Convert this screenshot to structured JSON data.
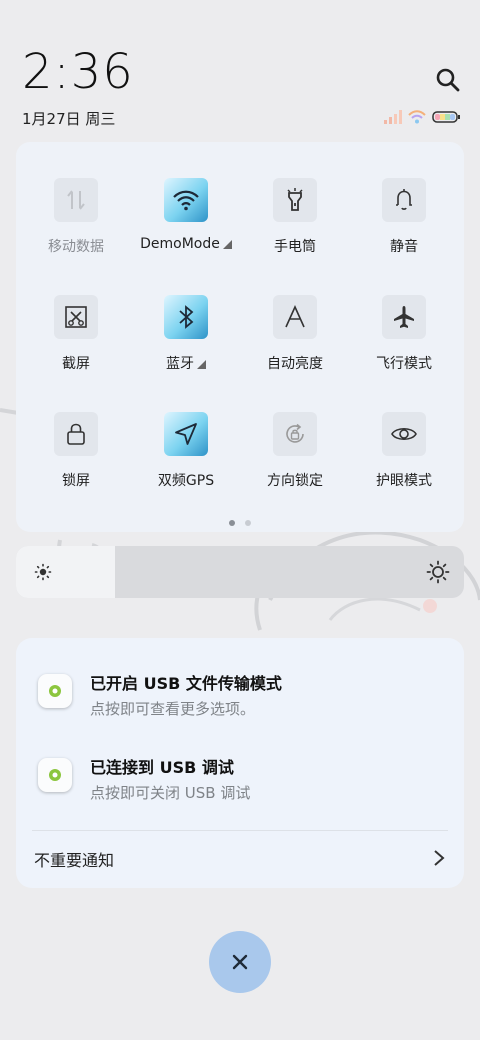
{
  "status": {
    "time": "2:36",
    "date": "1月27日 周三"
  },
  "quick_tiles": {
    "row1": [
      {
        "label": "移动数据",
        "icon": "mobile-data-icon",
        "active": false
      },
      {
        "label": "DemoMode",
        "icon": "wifi-icon",
        "active": true
      },
      {
        "label": "手电筒",
        "icon": "flashlight-icon",
        "active": false
      },
      {
        "label": "静音",
        "icon": "bell-icon",
        "active": false
      }
    ],
    "row2": [
      {
        "label": "截屏",
        "icon": "screenshot-icon",
        "active": false
      },
      {
        "label": "蓝牙",
        "icon": "bluetooth-icon",
        "active": true
      },
      {
        "label": "自动亮度",
        "icon": "auto-brightness-icon",
        "active": false
      },
      {
        "label": "飞行模式",
        "icon": "airplane-icon",
        "active": false
      }
    ],
    "row3": [
      {
        "label": "锁屏",
        "icon": "lock-icon",
        "active": false
      },
      {
        "label": "双频GPS",
        "icon": "location-arrow-icon",
        "active": true
      },
      {
        "label": "方向锁定",
        "icon": "rotation-lock-icon",
        "active": false
      },
      {
        "label": "护眼模式",
        "icon": "eye-icon",
        "active": false
      }
    ],
    "pages": 2,
    "current_page": 1
  },
  "brightness": {
    "level": 0.22
  },
  "notifications": [
    {
      "title": "已开启 USB 文件传输模式",
      "subtitle": "点按即可查看更多选项。",
      "icon": "android-system-icon"
    },
    {
      "title": "已连接到 USB 调试",
      "subtitle": "点按即可关闭 USB 调试",
      "icon": "android-system-icon"
    }
  ],
  "minor_notifications": {
    "label": "不重要通知"
  },
  "colors": {
    "accent": "#a9c8ec",
    "tile_active": "#2e93c8",
    "panel": "#eef2f8"
  }
}
